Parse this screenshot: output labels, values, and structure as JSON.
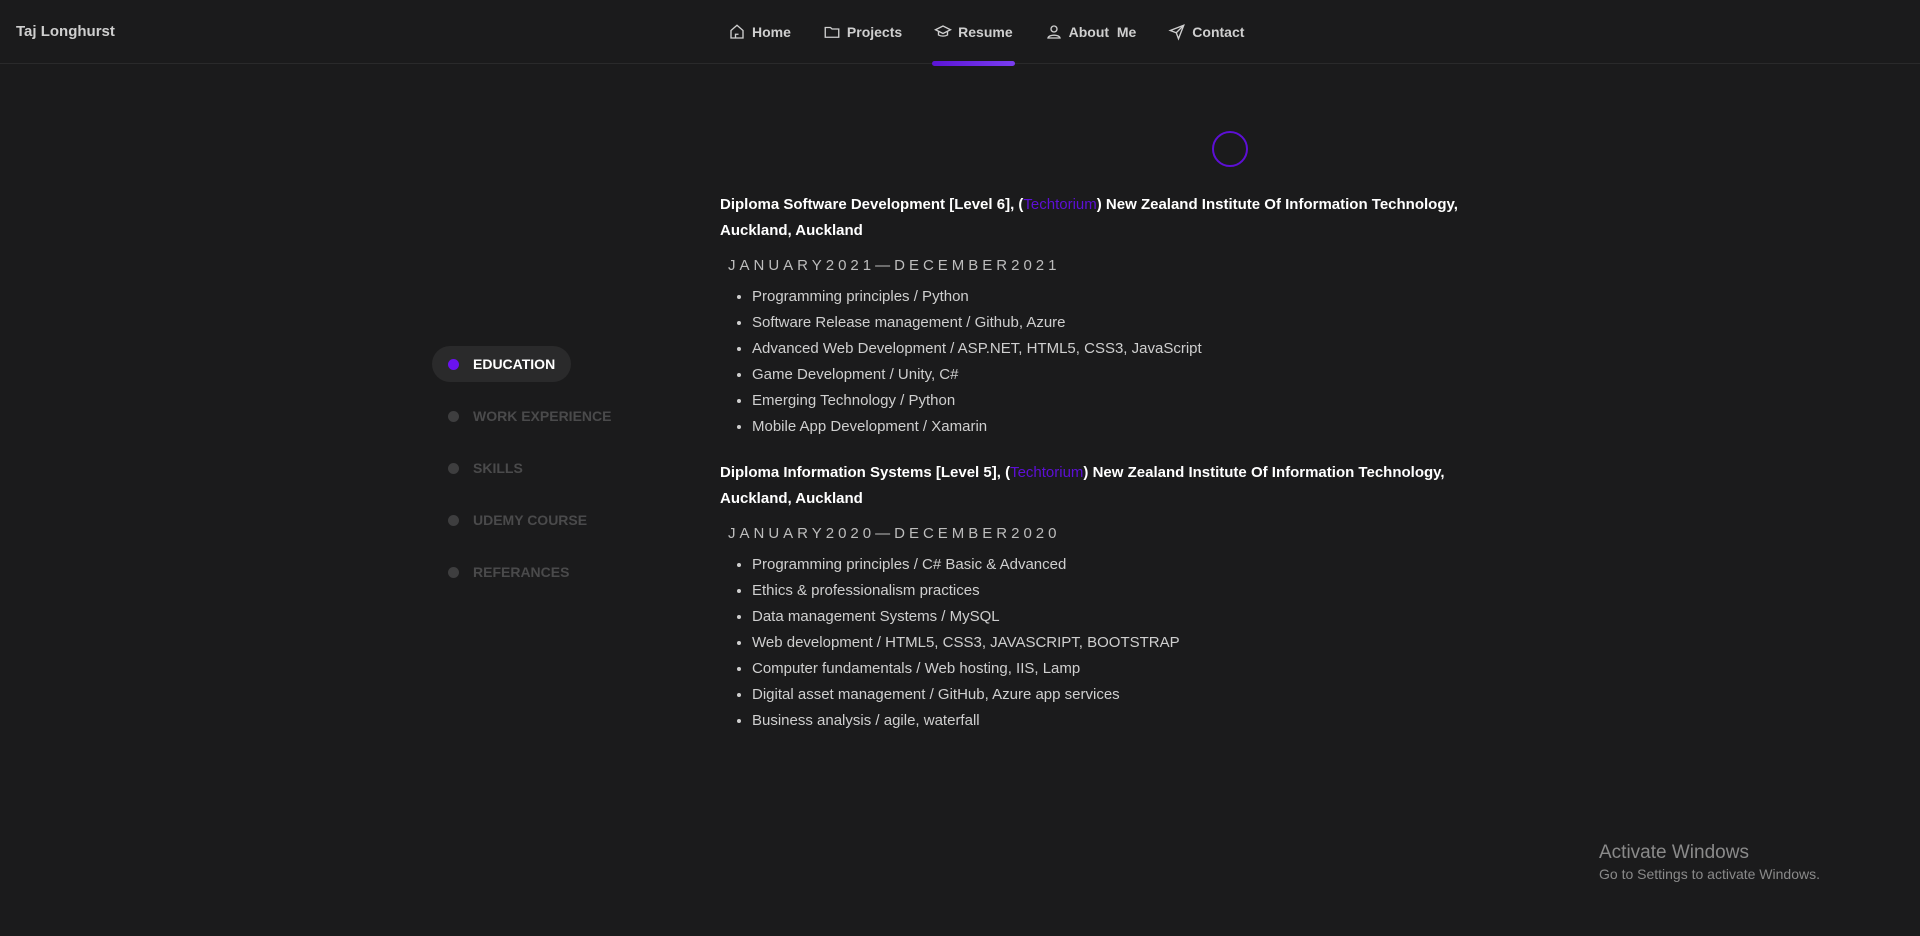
{
  "brand": "Taj Longhurst",
  "nav": [
    {
      "label": "Home",
      "icon": "home-icon"
    },
    {
      "label": "Projects",
      "icon": "folder-icon"
    },
    {
      "label": "Resume",
      "icon": "graduation-cap-icon",
      "active": true
    },
    {
      "label": "About  Me",
      "icon": "user-icon"
    },
    {
      "label": "Contact",
      "icon": "send-icon"
    }
  ],
  "sidebar": [
    {
      "label": "EDUCATION",
      "active": true
    },
    {
      "label": "WORK EXPERIENCE"
    },
    {
      "label": "SKILLS"
    },
    {
      "label": "UDEMY COURSE"
    },
    {
      "label": "REFERANCES"
    }
  ],
  "education": [
    {
      "title_pre": "Diploma Software Development [Level 6], (",
      "school": "Techtorium",
      "title_post": ") New Zealand Institute Of Information Technology, Auckland, Auckland",
      "dates": "JANUARY2021—DECEMBER2021",
      "items": [
        "Programming principles / Python",
        "Software Release management / Github, Azure",
        "Advanced Web Development / ASP.NET, HTML5, CSS3, JavaScript",
        "Game Development / Unity, C#",
        "Emerging Technology / Python",
        "Mobile App Development / Xamarin"
      ]
    },
    {
      "title_pre": "Diploma Information Systems [Level 5], (",
      "school": "Techtorium",
      "title_post": ") New Zealand Institute Of Information Technology, Auckland, Auckland",
      "dates": "JANUARY2020—DECEMBER2020",
      "items": [
        "Programming principles / C# Basic & Advanced",
        "Ethics & professionalism practices",
        "Data management Systems / MySQL",
        "Web development / HTML5, CSS3, JAVASCRIPT, BOOTSTRAP",
        "Computer fundamentals / Web hosting, IIS, Lamp",
        "Digital asset management / GitHub, Azure app services",
        "Business analysis / agile, waterfall"
      ]
    }
  ],
  "watermark": {
    "line1": "Activate Windows",
    "line2": "Go to Settings to activate Windows."
  },
  "colors": {
    "accent": "#5d0fd6",
    "background": "#1b1b1c"
  }
}
